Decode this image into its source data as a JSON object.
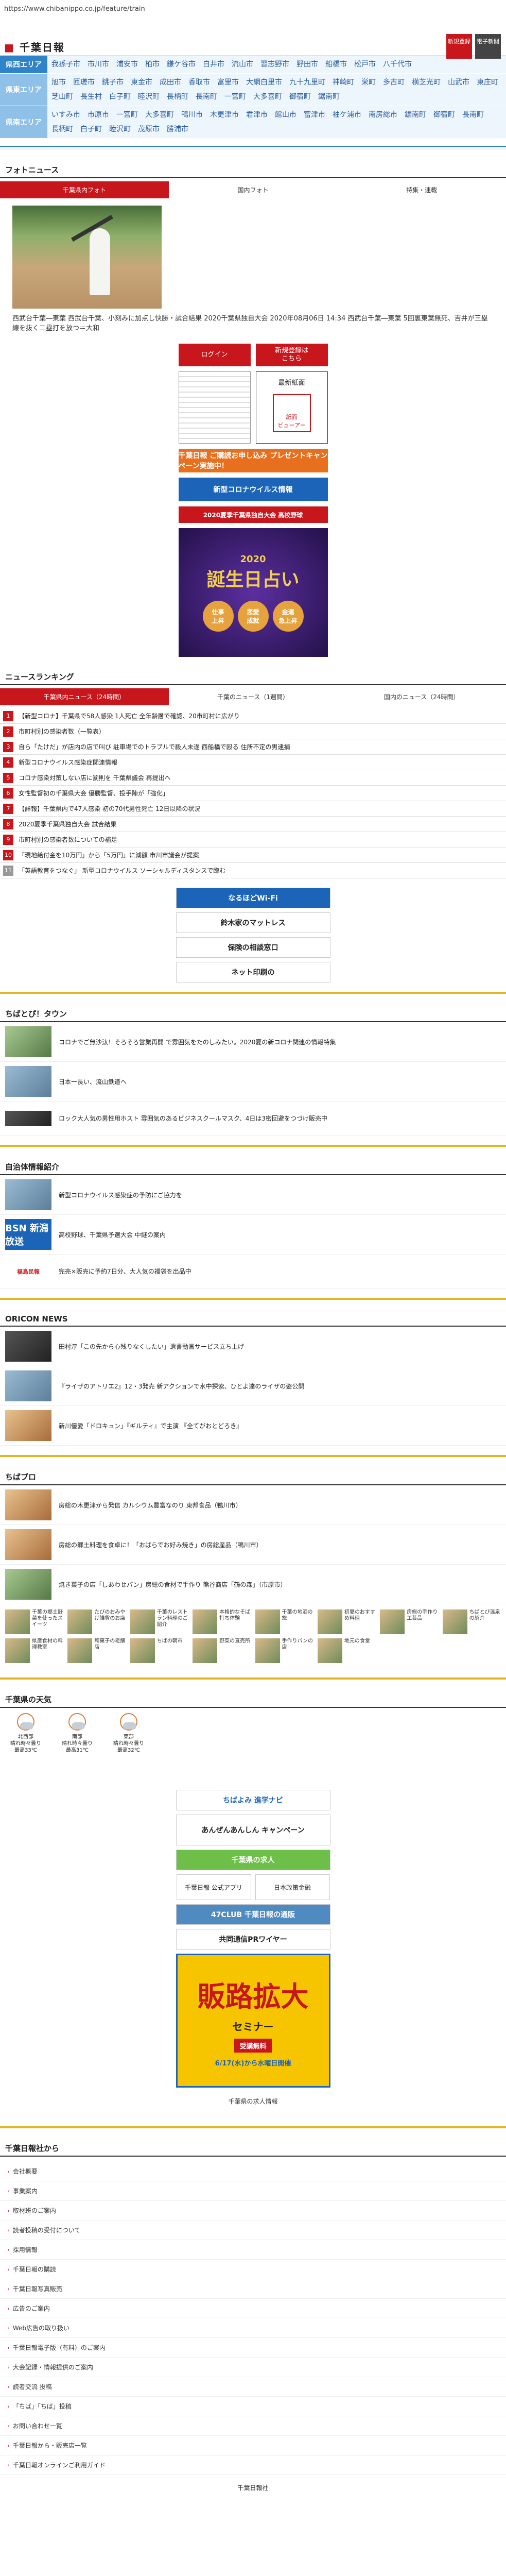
{
  "url": "https://www.chibanippo.co.jp/feature/train",
  "header": {
    "logo": "千葉日報",
    "btn_signup": "新規登録",
    "btn_epaper": "電子新聞"
  },
  "areas": [
    {
      "label": "県西エリア",
      "links": [
        "我孫子市",
        "市川市",
        "浦安市",
        "柏市",
        "鎌ケ谷市",
        "白井市",
        "流山市",
        "習志野市",
        "野田市",
        "船橋市",
        "松戸市",
        "八千代市"
      ]
    },
    {
      "label": "県東エリア",
      "links": [
        "旭市",
        "匝瑳市",
        "銚子市",
        "東金市",
        "成田市",
        "香取市",
        "富里市",
        "大網白里市",
        "九十九里町",
        "神崎町",
        "栄町",
        "多古町",
        "横芝光町",
        "山武市",
        "東庄町",
        "芝山町",
        "長生村",
        "白子町",
        "睦沢町",
        "長柄町",
        "長南町",
        "一宮町",
        "大多喜町",
        "御宿町",
        "鋸南町"
      ]
    },
    {
      "label": "県南エリア",
      "links": [
        "いすみ市",
        "市原市",
        "一宮町",
        "大多喜町",
        "鴨川市",
        "木更津市",
        "君津市",
        "館山市",
        "富津市",
        "袖ケ浦市",
        "南房総市",
        "鋸南町",
        "御宿町",
        "長南町",
        "長柄町",
        "白子町",
        "睦沢町",
        "茂原市",
        "勝浦市"
      ]
    }
  ],
  "photo_news": {
    "title": "フォトニュース",
    "tabs": [
      "千葉県内フォト",
      "国内フォト",
      "特集・連載"
    ],
    "caption": "西武台千葉―東葉 西武台千葉、小刻みに加点し快勝・試合結果 2020千葉県独自大会 2020年08月06日 14:34 西武台千葉―東葉 5回裏東葉無死、吉井が三塁線を抜く二塁打を放つ＝大和",
    "login": "ログイン",
    "signup": "新規登録は\nこちら",
    "latest_paper": "最新紙面",
    "paper_viewer": "紙面\nビューアー",
    "banner_campaign": "千葉日報 ご購読お申し込み プレゼントキャンペーン実施中！",
    "banner_corona": "新型コロナウイルス情報",
    "banner_baseball": "2020夏季千葉県独自大会 高校野球",
    "fortune_year": "2020",
    "fortune_title": "誕生日占い",
    "fortune_items": [
      "仕事\n上昇",
      "恋愛\n成就",
      "金運\n急上昇"
    ]
  },
  "ranking": {
    "title": "ニュースランキング",
    "tabs": [
      "千葉県内ニュース（24時間）",
      "千葉のニュース（1週間）",
      "国内のニュース（24時間）"
    ],
    "items": [
      "【新型コロナ】千葉県で58人感染 1人死亡 全年齢層で確認、20市町村に広がり",
      "市町村別の感染者数（一覧表）",
      "自ら「たけだ」が店内の店で叫び 駐車場でのトラブルで殺人未遂 西船橋で殴る 住所不定の男逮捕",
      "新型コロナウイルス感染症関連情報",
      "コロナ感染対策しない店に罰則を 千葉県議会 再提出へ",
      "女性監督初の千葉県大会 優勝監督、投手陣が「強化」",
      "【詳報】千葉県内で47人感染 初の70代男性死亡 12日以降の状況",
      "2020夏季千葉県独自大会 試合結果",
      "市町村別の感染者数についての補足",
      "「現地給付金を10万円」から「5万円」に減額 市川市議会が提案",
      "「英語教育をつなぐ」 新型コロナウイルス ソーシャルディスタンスで臨む"
    ]
  },
  "ads": [
    "なるほどWi-Fi",
    "鈴木家のマットレス",
    "保険の相談窓口",
    "ネット印刷の"
  ],
  "chibatoku": {
    "title": "ちばとぴ！タウン",
    "items": [
      "コロナでご無沙汰！そろそろ営業再開 で雰囲気をたのしみたい。2020夏の新コロナ関連の情報特集",
      "日本一長い、流山鉄道へ",
      "ロック大人気の男性用ホスト 雰囲気のあるビジネスクールマスク、4日は3密回避をつづけ販売中"
    ]
  },
  "jichitai": {
    "title": "自治体情報紹介",
    "items": [
      "新型コロナウイルス感染症の予防にご協力を",
      "高校野球、千葉県予選大会 中継の案内",
      "完売×販売に予約7日分、大人気の福袋を出品中"
    ],
    "bsn": "BSN\n新潟放送",
    "fukushima": "福島民報"
  },
  "oricon": {
    "title": "ORICON NEWS",
    "items": [
      "田村淳「この先から心残りなくしたい」遺書動画サービス立ち上げ",
      "『ライザのアトリエ2』12・3発売 新アクションで水中探索、ひとよ達のライザの姿公開",
      "新川優愛「ドロキュン」『ギルティ』で主演 『全てがおとどろき』"
    ]
  },
  "chibapro": {
    "title": "ちばプロ",
    "items": [
      "房総の木更津から発信 カルシウム豊富なのり 東邦食品（鴨川市）",
      "房総の郷土料理を食卓に！「おばらでお好み焼き」の房総産品（鴨川市）",
      "焼き菓子の店「しあわせパン」房総の食材で手作り 熊谷商店「鶴の森」（市原市）"
    ],
    "grid": [
      "千葉の郷土野菜を使ったスイーツ",
      "たびのおみやげ雑貨のお店",
      "千葉のレストラン料理のご紹介",
      "本格的なそば打ち体験",
      "千葉の地酒の旅",
      "初夏のおすすめ料理",
      "房総の手作り工芸品",
      "ちばとぴ温泉の紹介",
      "県産食材の料理教室",
      "和菓子の老舗店",
      "ちばの朝市",
      "野菜の直売所",
      "手作りパンの店",
      "地元の食堂"
    ]
  },
  "weather": {
    "title": "千葉県の天気",
    "items": [
      "北西部\n晴れ時々曇り\n最高33℃",
      "南部\n晴れ時々曇り\n最高31℃",
      "東部\n晴れ時々曇り\n最高32℃"
    ]
  },
  "side_ads": [
    "ちばよみ 進学ナビ",
    "あんぜんあんしん キャンペーン",
    "千葉県の求人",
    "千葉日報 公式アプリ",
    "47CLUB 千葉日報の通販",
    "日本政策金融",
    "共同通信PRワイヤー"
  ],
  "seminar": {
    "title": "販路拡大",
    "sub": "セミナー",
    "free": "受講無料",
    "date": "6/17(水)から水曜日開催"
  },
  "ads_link": "千葉県の求人情報",
  "footer": {
    "title": "千葉日報社から",
    "links": [
      "会社概要",
      "事業案内",
      "取材班のご案内",
      "読者投稿の受付について",
      "採用情報",
      "千葉日報の購読",
      "千葉日報写真販売",
      "広告のご案内",
      "Web広告の取り扱い",
      "千葉日報電子版（有料）のご案内",
      "大会記録・情報提供のご案内",
      "読者交流 投稿",
      "「ちば」「ちば」投稿",
      "お問い合わせ一覧",
      "千葉日報から・販売店一覧",
      "千葉日報オンラインご利用ガイド"
    ],
    "copyright": "千葉日報社"
  }
}
